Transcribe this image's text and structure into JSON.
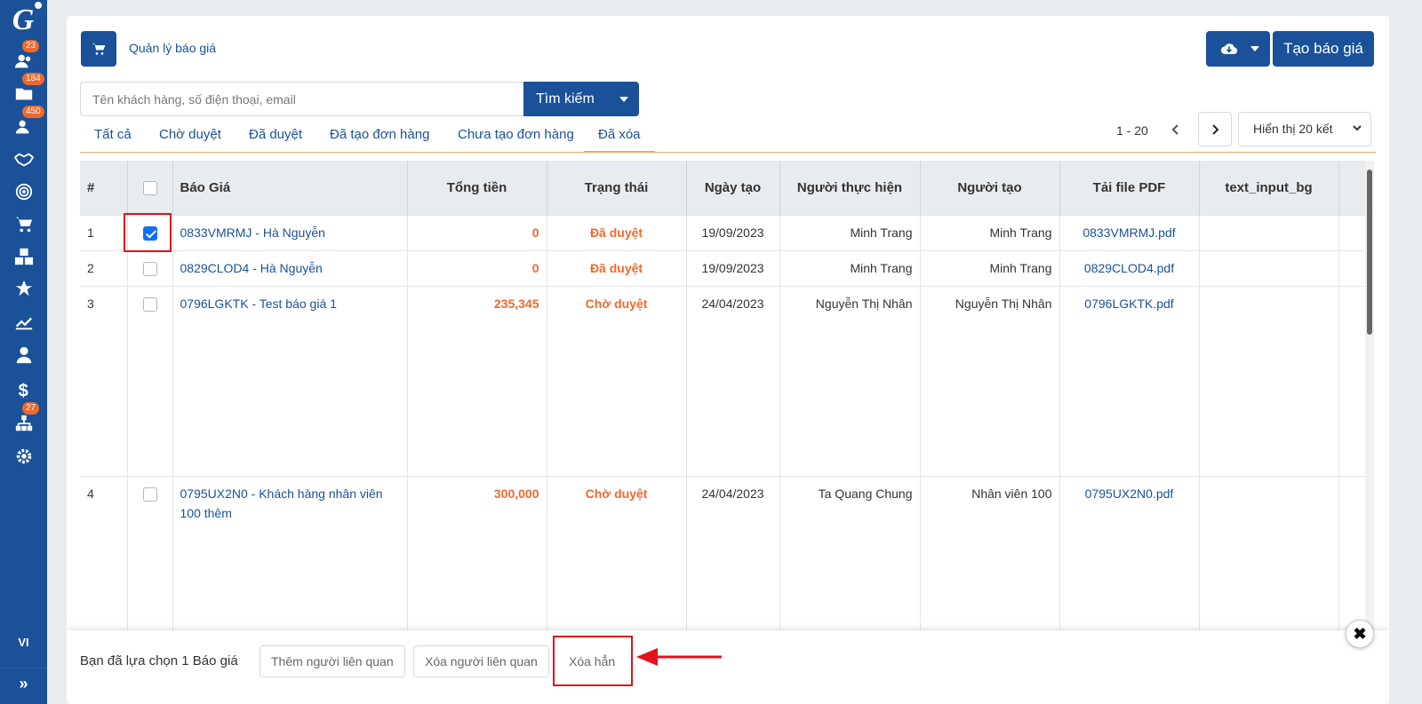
{
  "sidebar": {
    "logo_letter": "G",
    "items": [
      {
        "icon": "user-group-icon",
        "badge": "23"
      },
      {
        "icon": "folder-icon",
        "badge": "184"
      },
      {
        "icon": "contacts-icon",
        "badge": "450"
      },
      {
        "icon": "handshake-icon",
        "badge": ""
      },
      {
        "icon": "target-icon",
        "badge": ""
      },
      {
        "icon": "cart-icon",
        "badge": ""
      },
      {
        "icon": "boxes-icon",
        "badge": ""
      },
      {
        "icon": "star-icon",
        "badge": ""
      },
      {
        "icon": "chart-line-icon",
        "badge": ""
      },
      {
        "icon": "user-tie-icon",
        "badge": ""
      },
      {
        "icon": "dollar-icon",
        "badge": ""
      },
      {
        "icon": "sitemap-icon",
        "badge": "27"
      },
      {
        "icon": "gear-icon",
        "badge": ""
      }
    ],
    "language": "VI",
    "expand_label": "»"
  },
  "header": {
    "title": "Quản lý báo giá",
    "create_label": "Tạo báo giá"
  },
  "search": {
    "placeholder": "Tên khách hàng, số điện thoại, email",
    "button_label": "Tìm kiếm"
  },
  "tabs": [
    {
      "label": "Tất cả",
      "active": false
    },
    {
      "label": "Chờ duyệt",
      "active": false
    },
    {
      "label": "Đã duyệt",
      "active": false
    },
    {
      "label": "Đã tạo đơn hàng",
      "active": false
    },
    {
      "label": "Chưa tạo đơn hàng",
      "active": false
    },
    {
      "label": "Đã xóa",
      "active": true
    }
  ],
  "pager": {
    "range": "1 - 20",
    "per_page": "Hiển thị 20 kết"
  },
  "table": {
    "headers": [
      "#",
      "",
      "Báo Giá",
      "Tổng tiền",
      "Trạng thái",
      "Ngày tạo",
      "Người thực hiện",
      "Người tạo",
      "Tải file PDF",
      "text_input_bg"
    ],
    "rows": [
      {
        "idx": "1",
        "checked": true,
        "name": "0833VMRMJ - Hà Nguyễn",
        "total": "0",
        "status": "Đã duyệt",
        "date": "19/09/2023",
        "assignee": "Minh Trang",
        "creator": "Minh Trang",
        "pdf": "0833VMRMJ.pdf"
      },
      {
        "idx": "2",
        "checked": false,
        "name": "0829CLOD4 - Hà Nguyễn",
        "total": "0",
        "status": "Đã duyệt",
        "date": "19/09/2023",
        "assignee": "Minh Trang",
        "creator": "Minh Trang",
        "pdf": "0829CLOD4.pdf"
      },
      {
        "idx": "3",
        "checked": false,
        "name": "0796LGKTK - Test báo giá 1",
        "total": "235,345",
        "status": "Chờ duyệt",
        "date": "24/04/2023",
        "assignee": "Nguyễn Thị Nhân",
        "creator": "Nguyễn Thị Nhân",
        "pdf": "0796LGKTK.pdf"
      },
      {
        "idx": "4",
        "checked": false,
        "name": "0795UX2N0 - Khách hàng nhân viên 100 thêm",
        "total": "300,000",
        "status": "Chờ duyệt",
        "date": "24/04/2023",
        "assignee": "Ta Quang Chung",
        "creator": "Nhân viên 100",
        "pdf": "0795UX2N0.pdf"
      }
    ]
  },
  "bulk": {
    "selected_text": "Bạn đã lựa chọn 1 Báo giá",
    "add_related": "Thêm người liên quan",
    "remove_related": "Xóa người liên quan",
    "delete_permanent": "Xóa hẳn",
    "close_label": "✖"
  },
  "colors": {
    "primary": "#1a5199",
    "accent": "#f0692c",
    "highlight": "#e0121a"
  }
}
